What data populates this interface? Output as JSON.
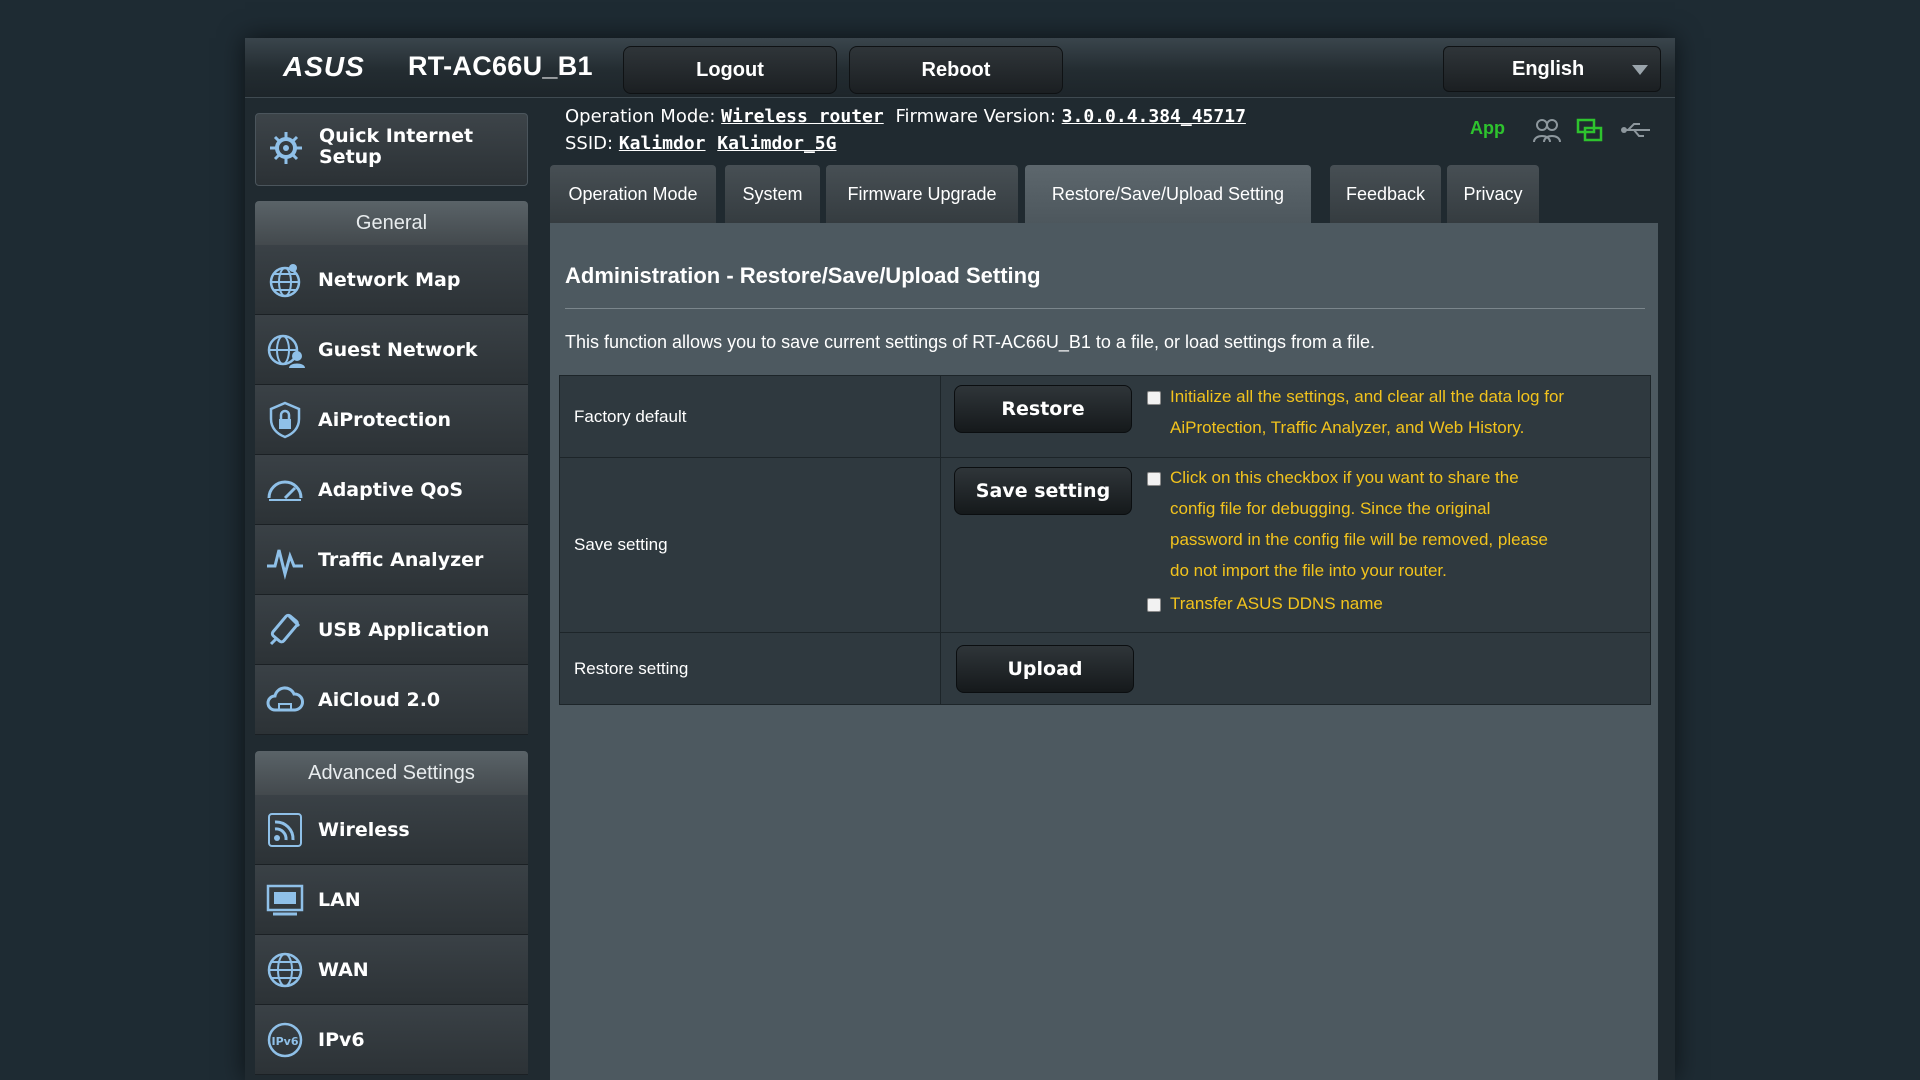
{
  "header": {
    "brand": "ASUS",
    "model": "RT-AC66U_B1",
    "logout_label": "Logout",
    "reboot_label": "Reboot",
    "language": "English"
  },
  "info": {
    "operation_mode_label": "Operation Mode:",
    "operation_mode_value": "Wireless router",
    "firmware_label": "Firmware Version:",
    "firmware_value": "3.0.0.4.384_45717",
    "ssid_label": "SSID:",
    "ssid_1": "Kalimdor",
    "ssid_2": "Kalimdor_5G",
    "app_label": "App"
  },
  "sidebar": {
    "quick_setup": "Quick Internet Setup",
    "general_title": "General",
    "general_items": [
      {
        "label": "Network Map",
        "icon": "globe-network-icon"
      },
      {
        "label": "Guest Network",
        "icon": "guest-network-icon"
      },
      {
        "label": "AiProtection",
        "icon": "shield-lock-icon"
      },
      {
        "label": "Adaptive QoS",
        "icon": "speedometer-icon"
      },
      {
        "label": "Traffic Analyzer",
        "icon": "waveform-icon"
      },
      {
        "label": "USB Application",
        "icon": "usb-icon"
      },
      {
        "label": "AiCloud 2.0",
        "icon": "cloud-icon"
      }
    ],
    "advanced_title": "Advanced Settings",
    "advanced_items": [
      {
        "label": "Wireless",
        "icon": "wifi-icon"
      },
      {
        "label": "LAN",
        "icon": "lan-icon"
      },
      {
        "label": "WAN",
        "icon": "wan-globe-icon"
      },
      {
        "label": "IPv6",
        "icon": "ipv6-icon"
      }
    ]
  },
  "tabs": [
    {
      "label": "Operation Mode"
    },
    {
      "label": "System"
    },
    {
      "label": "Firmware Upgrade"
    },
    {
      "label": "Restore/Save/Upload Setting",
      "active": true
    },
    {
      "label": "Feedback"
    },
    {
      "label": "Privacy"
    }
  ],
  "main": {
    "title": "Administration - Restore/Save/Upload Setting",
    "description": "This function allows you to save current settings of RT-AC66U_B1 to a file, or load settings from a file.",
    "rows": {
      "factory": {
        "label": "Factory default",
        "button": "Restore",
        "note_line1": "Initialize all the settings, and clear all the data log for",
        "note_line2": "AiProtection, Traffic Analyzer, and Web History."
      },
      "save": {
        "label": "Save setting",
        "button": "Save setting",
        "note_line1": "Click on this checkbox if you want to share the",
        "note_line2": "config file for debugging. Since the original",
        "note_line3": "password in the config file will be removed, please",
        "note_line4": "do not import the file into your router.",
        "ddns_label": "Transfer ASUS DDNS name"
      },
      "restore": {
        "label": "Restore setting",
        "button": "Upload"
      }
    }
  },
  "colors": {
    "note": "#f2c31d",
    "app_green": "#2ec32e",
    "content_bg": "#4d5960"
  }
}
